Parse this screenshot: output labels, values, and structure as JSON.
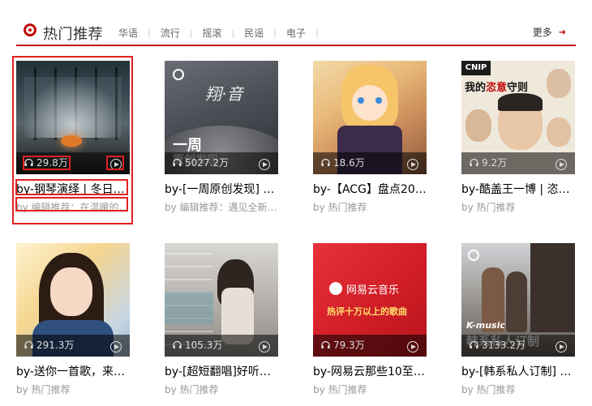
{
  "header": {
    "title": "热门推荐",
    "tabs": [
      {
        "label": "华语"
      },
      {
        "label": "流行"
      },
      {
        "label": "摇滚"
      },
      {
        "label": "民谣"
      },
      {
        "label": "电子"
      }
    ],
    "more_label": "更多",
    "accent": "#c10d0c"
  },
  "cards": [
    {
      "plays": "29.8万",
      "name": "by-钢琴演绎 | 冬日…",
      "sub": "by 编辑推荐：在温暖的…",
      "cover_text": ""
    },
    {
      "plays": "5027.2万",
      "name": "by-[一周原创发现] …",
      "sub": "by 编辑推荐：遇见全新…",
      "cover_text": "一周\n原创发现"
    },
    {
      "plays": "18.6万",
      "name": "by-【ACG】盘点20…",
      "sub": "by 热门推荐",
      "cover_text": ""
    },
    {
      "plays": "9.2万",
      "name": "by-酷盖王一博 | 恣…",
      "sub": "by 热门推荐",
      "cover_text": "我的恣意守则"
    },
    {
      "plays": "291.3万",
      "name": "by-送你一首歌，来…",
      "sub": "by 热门推荐",
      "cover_text": ""
    },
    {
      "plays": "105.3万",
      "name": "by-[超短翻唱]好听的…",
      "sub": "by 热门推荐",
      "cover_text": ""
    },
    {
      "plays": "79.3万",
      "name": "by-网易云那些10至…",
      "sub": "by 热门推荐",
      "cover_text": "网易云音乐\n热评十万以上的歌曲"
    },
    {
      "plays": "3133.2万",
      "name": "by-[韩系私人订制] …",
      "sub": "by 热门推荐",
      "cover_text": "K-music\n韩系私人订制"
    }
  ]
}
